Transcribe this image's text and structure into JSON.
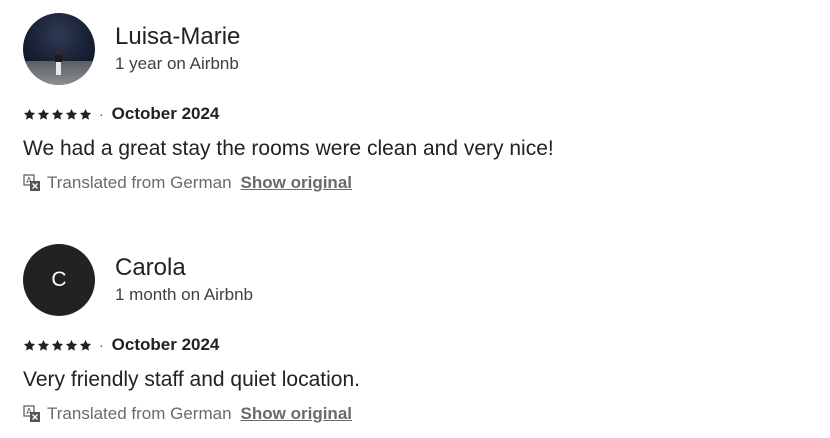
{
  "reviews": [
    {
      "name": "Luisa-Marie",
      "tenure": "1 year on Airbnb",
      "avatar": {
        "type": "photo",
        "icon": "user-photo"
      },
      "rating": 5,
      "separator": "·",
      "date": "October 2024",
      "text": "We had a great stay the rooms were clean and very nice!",
      "translation_note": "Translated from German",
      "show_original_label": "Show original"
    },
    {
      "name": "Carola",
      "tenure": "1 month on Airbnb",
      "avatar": {
        "type": "initial",
        "initial": "C",
        "background": "#222222"
      },
      "rating": 5,
      "separator": "·",
      "date": "October 2024",
      "text": "Very friendly staff and quiet location.",
      "translation_note": "Translated from German",
      "show_original_label": "Show original"
    }
  ],
  "icons": {
    "star": "star-icon",
    "translate": "translate-icon"
  },
  "colors": {
    "text_primary": "#222222",
    "text_secondary": "#6a6a6a",
    "avatar_dark": "#222222"
  }
}
